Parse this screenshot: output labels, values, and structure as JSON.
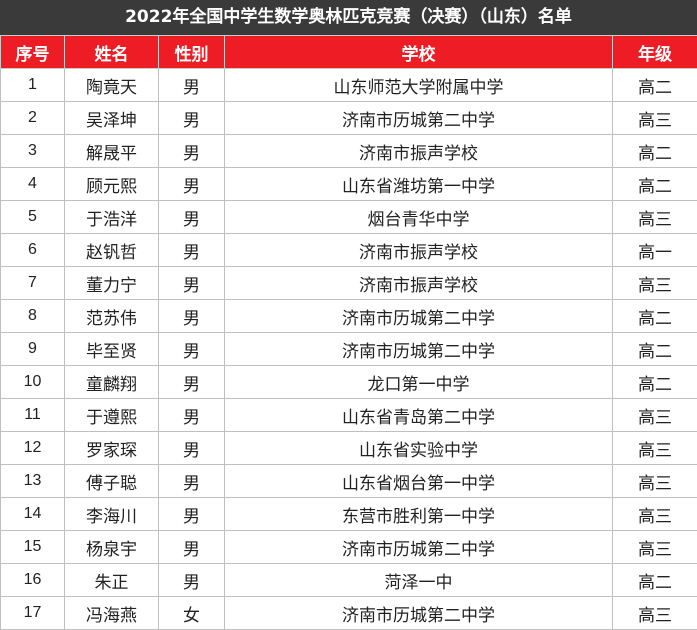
{
  "title": "2022年全国中学生数学奥林匹克竞赛（决赛）（山东）名单",
  "colors": {
    "title_bg": "#3a3a3a",
    "header_bg": "#ee1c24",
    "header_text": "#ffffff",
    "grid": "#bfbfbf"
  },
  "headers": {
    "no": "序号",
    "name": "姓名",
    "gender": "性别",
    "school": "学校",
    "grade": "年级"
  },
  "rows": [
    {
      "no": "1",
      "name": "陶竟天",
      "gender": "男",
      "school": "山东师范大学附属中学",
      "grade": "高二"
    },
    {
      "no": "2",
      "name": "吴泽坤",
      "gender": "男",
      "school": "济南市历城第二中学",
      "grade": "高三"
    },
    {
      "no": "3",
      "name": "解晟平",
      "gender": "男",
      "school": "济南市振声学校",
      "grade": "高二"
    },
    {
      "no": "4",
      "name": "顾元熙",
      "gender": "男",
      "school": "山东省潍坊第一中学",
      "grade": "高二"
    },
    {
      "no": "5",
      "name": "于浩洋",
      "gender": "男",
      "school": "烟台青华中学",
      "grade": "高三"
    },
    {
      "no": "6",
      "name": "赵钒哲",
      "gender": "男",
      "school": "济南市振声学校",
      "grade": "高一"
    },
    {
      "no": "7",
      "name": "董力宁",
      "gender": "男",
      "school": "济南市振声学校",
      "grade": "高三"
    },
    {
      "no": "8",
      "name": "范苏伟",
      "gender": "男",
      "school": "济南市历城第二中学",
      "grade": "高二"
    },
    {
      "no": "9",
      "name": "毕至贤",
      "gender": "男",
      "school": "济南市历城第二中学",
      "grade": "高二"
    },
    {
      "no": "10",
      "name": "童麟翔",
      "gender": "男",
      "school": "龙口第一中学",
      "grade": "高二"
    },
    {
      "no": "11",
      "name": "于遵熙",
      "gender": "男",
      "school": "山东省青岛第二中学",
      "grade": "高三"
    },
    {
      "no": "12",
      "name": "罗家琛",
      "gender": "男",
      "school": "山东省实验中学",
      "grade": "高三"
    },
    {
      "no": "13",
      "name": "傅子聪",
      "gender": "男",
      "school": "山东省烟台第一中学",
      "grade": "高三"
    },
    {
      "no": "14",
      "name": "李海川",
      "gender": "男",
      "school": "东营市胜利第一中学",
      "grade": "高三"
    },
    {
      "no": "15",
      "name": "杨泉宇",
      "gender": "男",
      "school": "济南市历城第二中学",
      "grade": "高三"
    },
    {
      "no": "16",
      "name": "朱正",
      "gender": "男",
      "school": "菏泽一中",
      "grade": "高二"
    },
    {
      "no": "17",
      "name": "冯海燕",
      "gender": "女",
      "school": "济南市历城第二中学",
      "grade": "高三"
    }
  ]
}
